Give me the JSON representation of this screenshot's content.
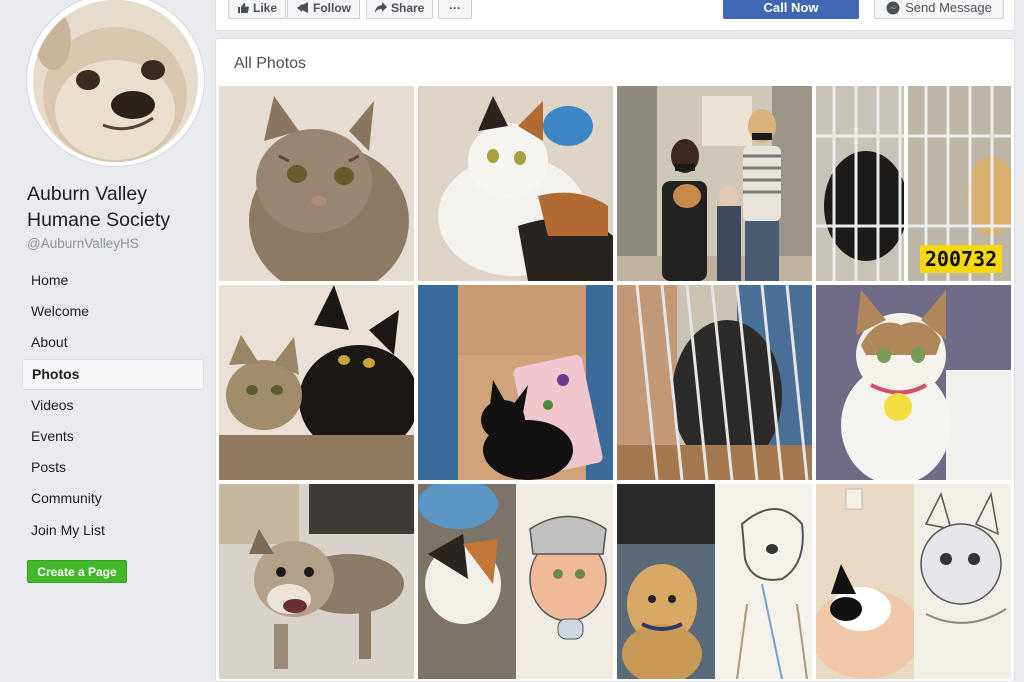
{
  "page": {
    "name": "Auburn Valley Humane Society",
    "handle": "@AuburnValleyHS"
  },
  "nav": {
    "items": [
      {
        "label": "Home"
      },
      {
        "label": "Welcome"
      },
      {
        "label": "About"
      },
      {
        "label": "Photos"
      },
      {
        "label": "Videos"
      },
      {
        "label": "Events"
      },
      {
        "label": "Posts"
      },
      {
        "label": "Community"
      },
      {
        "label": "Join My List"
      }
    ],
    "create_page": "Create a Page"
  },
  "actions": {
    "like": "Like",
    "follow": "Follow",
    "share": "Share",
    "more": "···",
    "call": "Call Now",
    "message": "Send Message"
  },
  "photos": {
    "title": "All Photos",
    "kennel_tag": "200732"
  },
  "colors": {
    "brand_blue": "#4267b2",
    "create_green": "#42b72a",
    "background": "#e9ebee"
  }
}
